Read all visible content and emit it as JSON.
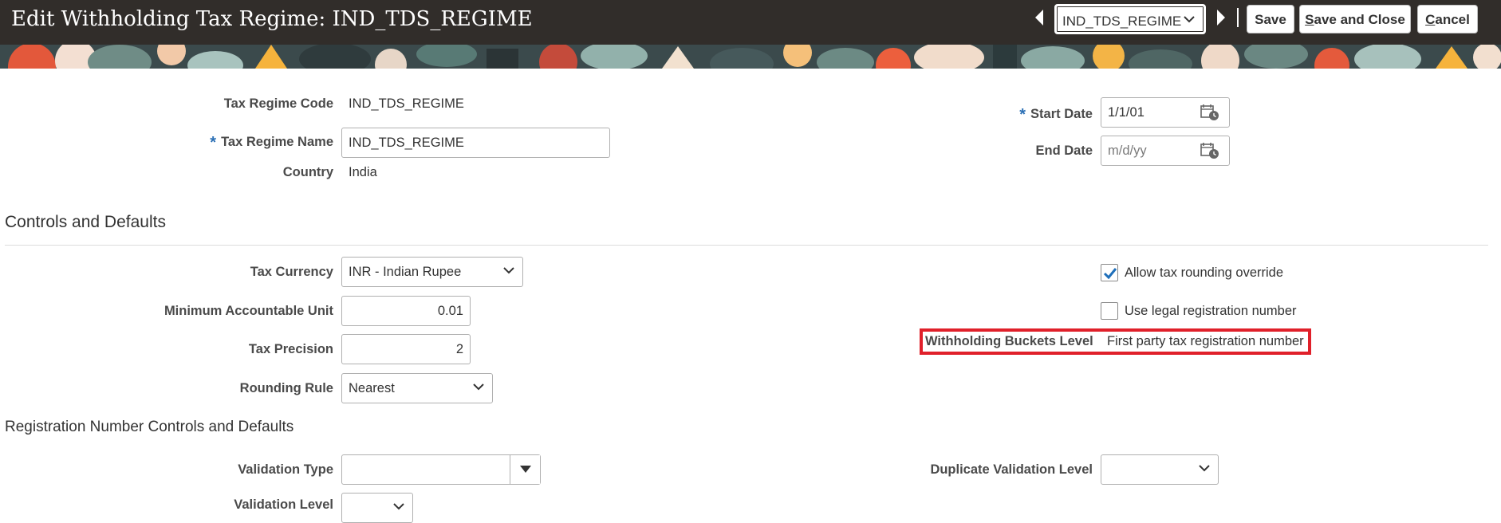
{
  "header": {
    "title": "Edit Withholding Tax Regime: IND_TDS_REGIME",
    "record_select_value": "IND_TDS_REGIME",
    "save_label": "Save",
    "save_close_label_mnemonic": "S",
    "save_close_label_rest": "ave and Close",
    "cancel_label_mnemonic": "C",
    "cancel_label_rest": "ancel"
  },
  "regime": {
    "code_label": "Tax Regime Code",
    "code_value": "IND_TDS_REGIME",
    "name_label": "Tax Regime Name",
    "name_value": "IND_TDS_REGIME",
    "country_label": "Country",
    "country_value": "India",
    "start_date_label": "Start Date",
    "start_date_value": "1/1/01",
    "end_date_label": "End Date",
    "end_date_placeholder": "m/d/yy",
    "required_mark": "*"
  },
  "controls": {
    "section_title": "Controls and Defaults",
    "tax_currency_label": "Tax Currency",
    "tax_currency_value": "INR - Indian Rupee",
    "min_unit_label": "Minimum Accountable Unit",
    "min_unit_value": "0.01",
    "precision_label": "Tax Precision",
    "precision_value": "2",
    "rounding_rule_label": "Rounding Rule",
    "rounding_rule_value": "Nearest",
    "allow_rounding_label": "Allow tax rounding override",
    "allow_rounding_checked": true,
    "use_legal_reg_label": "Use legal registration number",
    "use_legal_reg_checked": false,
    "buckets_label": "Withholding Buckets Level",
    "buckets_value": "First party tax registration number"
  },
  "registration": {
    "section_title": "Registration Number Controls and Defaults",
    "validation_type_label": "Validation Type",
    "validation_type_value": "",
    "duplicate_level_label": "Duplicate Validation Level",
    "duplicate_level_value": "",
    "validation_level_label": "Validation Level"
  },
  "colors": {
    "header_bg": "#312d2a",
    "required_star": "#2a6fb5",
    "checkbox_check": "#1f6fba",
    "highlight_border": "#e0202a"
  }
}
